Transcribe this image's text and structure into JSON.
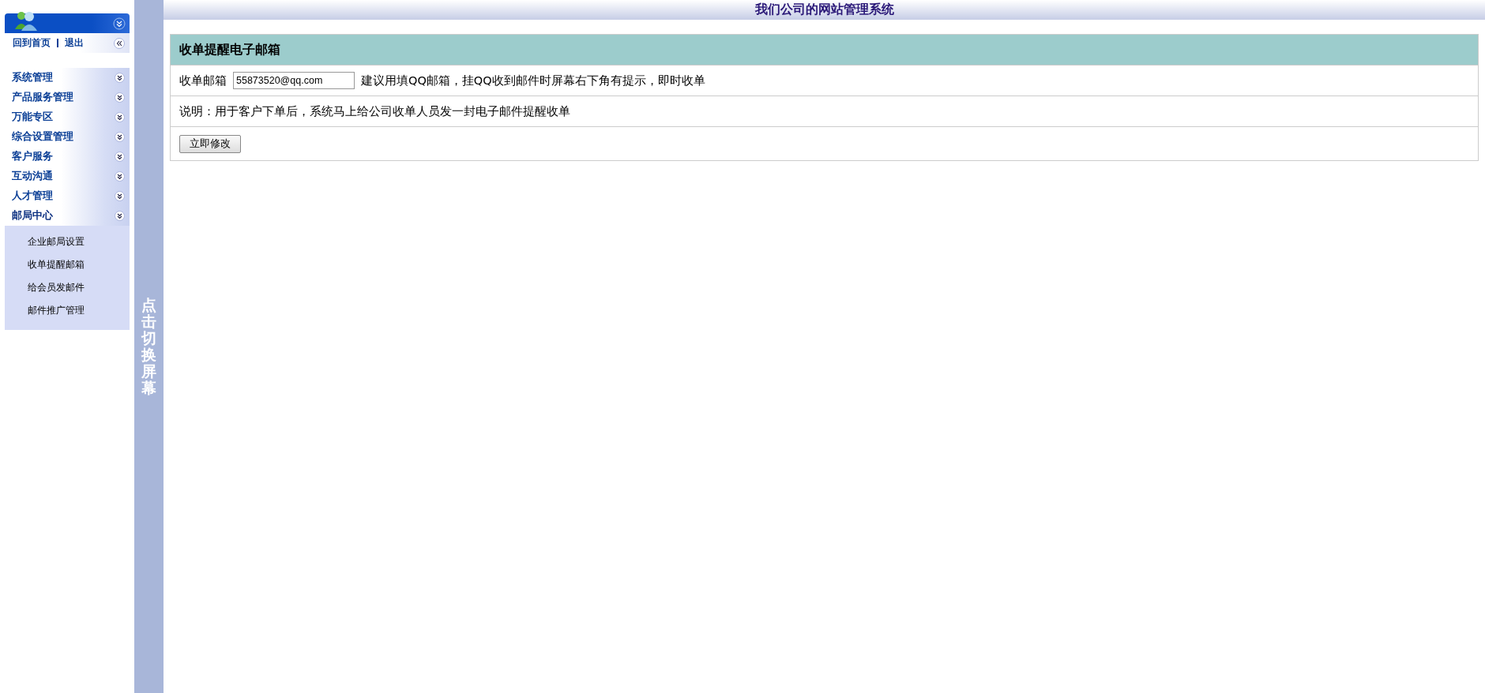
{
  "header": {
    "title": "我们公司的网站管理系统"
  },
  "sidebar": {
    "links": [
      {
        "label": "回到首页"
      },
      {
        "label": "退出"
      }
    ],
    "menu": [
      {
        "label": "系统管理",
        "expanded": false
      },
      {
        "label": "产品服务管理",
        "expanded": false
      },
      {
        "label": "万能专区",
        "expanded": false
      },
      {
        "label": "综合设置管理",
        "expanded": false
      },
      {
        "label": "客户服务",
        "expanded": false
      },
      {
        "label": "互动沟通",
        "expanded": false
      },
      {
        "label": "人才管理",
        "expanded": false
      },
      {
        "label": "邮局中心",
        "expanded": true,
        "children": [
          {
            "label": "企业邮局设置"
          },
          {
            "label": "收单提醒邮箱"
          },
          {
            "label": "给会员发邮件"
          },
          {
            "label": "邮件推广管理"
          }
        ]
      }
    ]
  },
  "toggle_bar": {
    "label": "点击切换屏幕"
  },
  "panel": {
    "title": "收单提醒电子邮箱",
    "field_label": "收单邮箱",
    "field_value": "55873520@qq.com",
    "hint": "建议用填QQ邮箱，挂QQ收到邮件时屏幕右下角有提示，即时收单",
    "note": "说明：用于客户下单后，系统马上给公司收单人员发一封电子邮件提醒收单",
    "button": "立即修改"
  }
}
